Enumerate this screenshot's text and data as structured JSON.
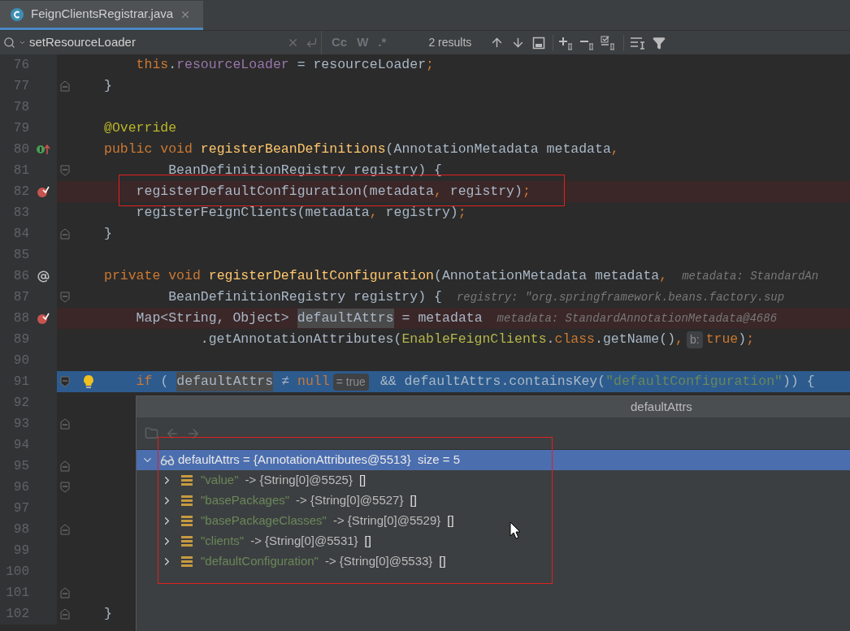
{
  "tab": {
    "title": "FeignClientsRegistrar.java",
    "selected": true
  },
  "search": {
    "query": "setResourceLoader",
    "options": [
      {
        "label": "Cc",
        "on": false
      },
      {
        "label": "W",
        "on": false
      },
      {
        "label": ".*",
        "on": false
      }
    ],
    "results": "2 results"
  },
  "lines": [
    {
      "number": "76",
      "kind": "plain",
      "tokens": [
        {
          "kind": "keyword",
          "text": "    this"
        },
        {
          "kind": "plain",
          "text": "."
        },
        {
          "kind": "field",
          "text": "resourceLoader"
        },
        {
          "kind": "plain",
          "text": " = resourceLoader"
        },
        {
          "kind": "punct",
          "text": ";"
        }
      ]
    },
    {
      "number": "77",
      "kind": "plain",
      "fold": {
        "kind": "end"
      },
      "tokens": [
        {
          "kind": "plain",
          "text": "}"
        }
      ]
    },
    {
      "number": "78",
      "kind": "plain"
    },
    {
      "number": "79",
      "kind": "plain",
      "tokens": [
        {
          "kind": "annotation",
          "text": "@Override"
        }
      ]
    },
    {
      "number": "80",
      "kind": "plain",
      "marker": {
        "kind": "implements"
      },
      "tokens": [
        {
          "kind": "keyword",
          "text": "public void "
        },
        {
          "kind": "method",
          "text": "registerBeanDefinitions"
        },
        {
          "kind": "plain",
          "text": "(AnnotationMetadata metadata"
        },
        {
          "kind": "punct",
          "text": ","
        }
      ]
    },
    {
      "number": "81",
      "kind": "plain",
      "fold": {
        "kind": "start"
      },
      "tokens": [
        {
          "kind": "plain",
          "text": "        BeanDefinitionRegistry registry) {"
        }
      ]
    },
    {
      "number": "82",
      "kind": "breakpoint",
      "tokens": [
        {
          "kind": "plain",
          "text": "    registerDefaultConfiguration(metadata"
        },
        {
          "kind": "punct",
          "text": ","
        },
        {
          "kind": "plain",
          "text": " registry)"
        },
        {
          "kind": "punct",
          "text": ";"
        }
      ]
    },
    {
      "number": "83",
      "kind": "plain",
      "tokens": [
        {
          "kind": "plain",
          "text": "    registerFeignClients(metadata"
        },
        {
          "kind": "punct",
          "text": ","
        },
        {
          "kind": "plain",
          "text": " registry)"
        },
        {
          "kind": "punct",
          "text": ";"
        }
      ]
    },
    {
      "number": "84",
      "kind": "plain",
      "fold": {
        "kind": "end"
      },
      "tokens": [
        {
          "kind": "plain",
          "text": "}"
        }
      ]
    },
    {
      "number": "85",
      "kind": "plain"
    },
    {
      "number": "86",
      "kind": "plain",
      "marker": {
        "kind": "at"
      },
      "tokens": [
        {
          "kind": "keyword",
          "text": "private void "
        },
        {
          "kind": "method",
          "text": "registerDefaultConfiguration"
        },
        {
          "kind": "plain",
          "text": "(AnnotationMetadata metadata"
        },
        {
          "kind": "punct",
          "text": ","
        },
        {
          "kind": "hint",
          "text": "metadata: StandardAn"
        }
      ]
    },
    {
      "number": "87",
      "kind": "plain",
      "fold": {
        "kind": "start"
      },
      "tokens": [
        {
          "kind": "plain",
          "text": "        BeanDefinitionRegistry registry) {"
        },
        {
          "kind": "hint",
          "text": "registry: \"org.springframework.beans.factory.sup"
        }
      ]
    },
    {
      "number": "88",
      "kind": "breakpoint",
      "tokens": [
        {
          "kind": "plain",
          "text": "    Map<String, Object>"
        },
        {
          "kind": "usage",
          "text": "defaultAttrs"
        },
        {
          "kind": "plain",
          "text": "= metadata"
        },
        {
          "kind": "hint",
          "text": "metadata: StandardAnnotationMetadata@4686"
        }
      ]
    },
    {
      "number": "89",
      "kind": "plain",
      "tokens": [
        {
          "kind": "plain",
          "text": "            .getAnnotationAttributes("
        },
        {
          "kind": "class",
          "text": "EnableFeignClients"
        },
        {
          "kind": "plain",
          "text": "."
        },
        {
          "kind": "keyword",
          "text": "class"
        },
        {
          "kind": "plain",
          "text": ".getName()"
        },
        {
          "kind": "punct",
          "text": ","
        },
        {
          "kind": "badge",
          "text": "b:"
        },
        {
          "kind": "keyword",
          "text": "true"
        },
        {
          "kind": "plain",
          "text": ")"
        },
        {
          "kind": "punct",
          "text": ";"
        }
      ]
    },
    {
      "number": "90",
      "kind": "plain"
    },
    {
      "number": "91",
      "kind": "current",
      "fold": {
        "kind": "start"
      },
      "tokens": [
        {
          "kind": "keyword",
          "text": "    if"
        },
        {
          "kind": "plain",
          "text": "("
        },
        {
          "kind": "usage",
          "text": "defaultAttrs"
        },
        {
          "kind": "plain",
          "text": "≠"
        },
        {
          "kind": "keyword",
          "text": "null"
        },
        {
          "kind": "badge",
          "text": "= true"
        },
        {
          "kind": "plain",
          "text": "&& defaultAttrs.containsKey("
        },
        {
          "kind": "string",
          "text": "\"defaultConfiguration\""
        },
        {
          "kind": "plain",
          "text": ")) {"
        }
      ]
    },
    {
      "number": "92",
      "kind": "plain"
    },
    {
      "number": "93",
      "kind": "plain",
      "fold": {
        "kind": "end"
      }
    },
    {
      "number": "94",
      "kind": "plain"
    },
    {
      "number": "95",
      "kind": "plain",
      "fold": {
        "kind": "end"
      }
    },
    {
      "number": "96",
      "kind": "plain",
      "fold": {
        "kind": "start"
      }
    },
    {
      "number": "97",
      "kind": "plain"
    },
    {
      "number": "98",
      "kind": "plain",
      "fold": {
        "kind": "end"
      }
    },
    {
      "number": "99",
      "kind": "plain"
    },
    {
      "number": "100",
      "kind": "plain"
    },
    {
      "number": "101",
      "kind": "plain",
      "fold": {
        "kind": "end"
      }
    },
    {
      "number": "102",
      "kind": "plain",
      "fold": {
        "kind": "end"
      },
      "tokens": [
        {
          "kind": "plain",
          "text": "}"
        }
      ]
    }
  ],
  "popup": {
    "title": "defaultAttrs",
    "root": {
      "text": "defaultAttrs = {AnnotationAttributes@5513}  size = 5",
      "expanded": true,
      "selected": true,
      "children": [
        {
          "key": "\"value\"",
          "value": "-> {String[0]@5525}",
          "suffix": "[]",
          "expanded": false,
          "selected": false
        },
        {
          "key": "\"basePackages\"",
          "value": "-> {String[0]@5527}",
          "suffix": "[]",
          "expanded": false,
          "selected": false
        },
        {
          "key": "\"basePackageClasses\"",
          "value": "-> {String[0]@5529}",
          "suffix": "[]",
          "expanded": false,
          "selected": false
        },
        {
          "key": "\"clients\"",
          "value": "-> {String[0]@5531}",
          "suffix": "[]",
          "expanded": false,
          "selected": false
        },
        {
          "key": "\"defaultConfiguration\"",
          "value": "-> {String[0]@5533}",
          "suffix": "[]",
          "expanded": false,
          "selected": false
        }
      ]
    }
  }
}
